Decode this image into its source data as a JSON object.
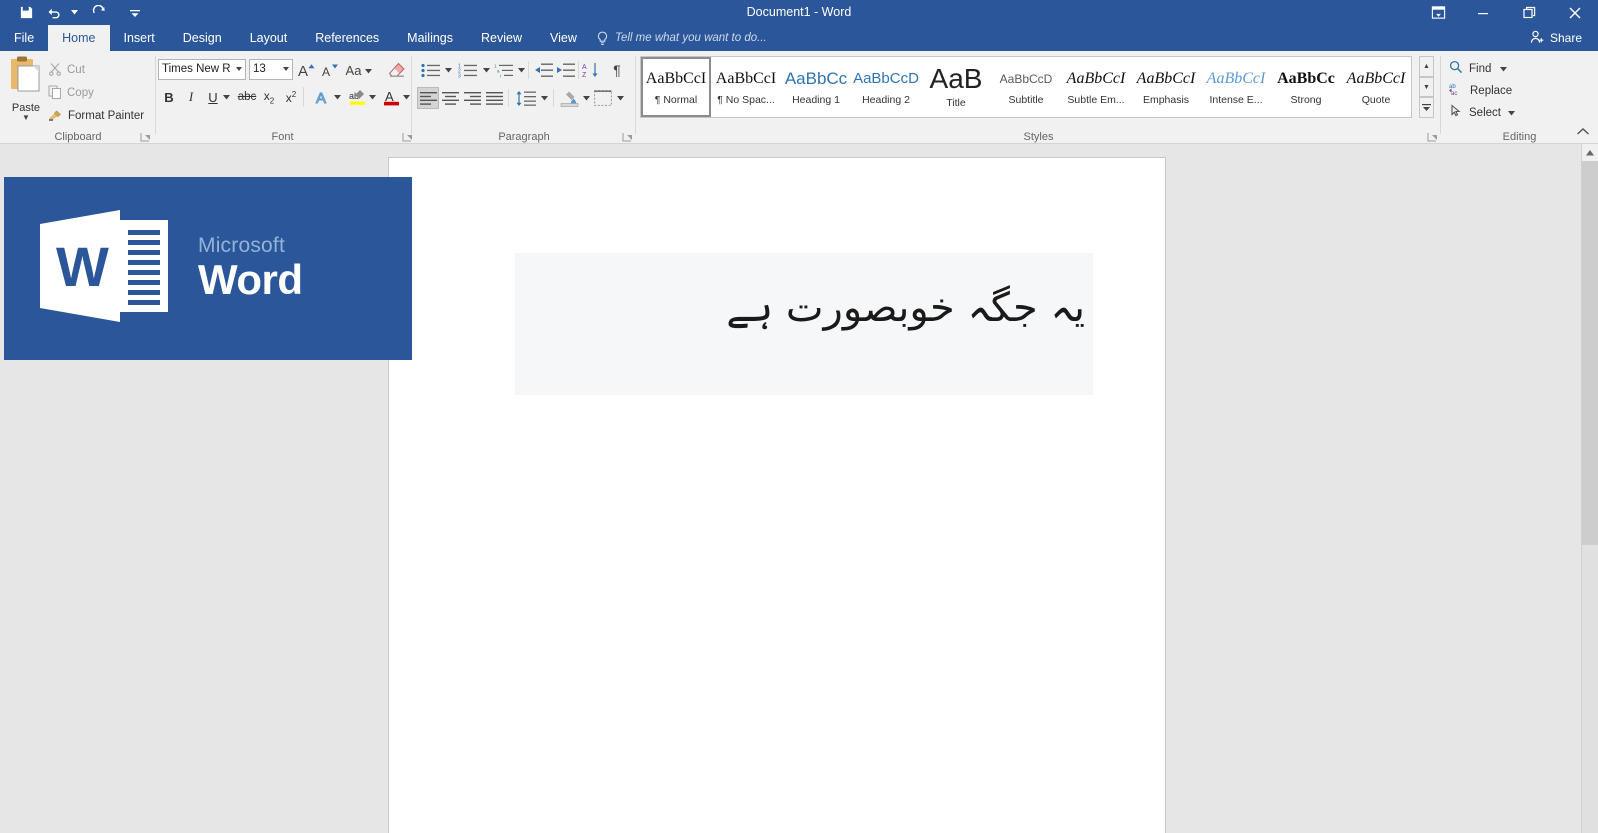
{
  "titlebar": {
    "document_title": "Document1 - Word",
    "qat": [
      {
        "name": "save-icon",
        "label": "Save"
      },
      {
        "name": "undo-icon",
        "label": "Undo"
      },
      {
        "name": "redo-icon",
        "label": "Repeat"
      },
      {
        "name": "customize-qat-icon",
        "label": "Customize Quick Access Toolbar"
      }
    ],
    "window": [
      {
        "name": "ribbon-display-options-icon",
        "label": "Ribbon Display Options"
      },
      {
        "name": "minimize-icon",
        "label": "Minimize"
      },
      {
        "name": "restore-icon",
        "label": "Restore Down"
      },
      {
        "name": "close-icon",
        "label": "Close"
      }
    ],
    "share_label": "Share",
    "accent_color": "#2b579a"
  },
  "tabs": [
    {
      "label": "File",
      "active": false
    },
    {
      "label": "Home",
      "active": true
    },
    {
      "label": "Insert",
      "active": false
    },
    {
      "label": "Design",
      "active": false
    },
    {
      "label": "Layout",
      "active": false
    },
    {
      "label": "References",
      "active": false
    },
    {
      "label": "Mailings",
      "active": false
    },
    {
      "label": "Review",
      "active": false
    },
    {
      "label": "View",
      "active": false
    }
  ],
  "tellme": {
    "placeholder": "Tell me what you want to do...",
    "icon": "lightbulb-icon"
  },
  "ribbon": {
    "clipboard": {
      "group_label": "Clipboard",
      "paste_label": "Paste",
      "cut_label": "Cut",
      "copy_label": "Copy",
      "format_painter_label": "Format Painter"
    },
    "font": {
      "group_label": "Font",
      "font_name": "Times New Ro",
      "font_size": "13",
      "buttons": [
        {
          "name": "grow-font-icon",
          "glyph": "A"
        },
        {
          "name": "shrink-font-icon",
          "glyph": "A"
        },
        {
          "name": "change-case-icon",
          "glyph": "Aa"
        },
        {
          "name": "clear-formatting-icon",
          "glyph": "✐"
        },
        {
          "name": "bold-icon",
          "glyph": "B"
        },
        {
          "name": "italic-icon",
          "glyph": "I"
        },
        {
          "name": "underline-icon",
          "glyph": "U"
        },
        {
          "name": "strikethrough-icon",
          "glyph": "abc"
        },
        {
          "name": "subscript-icon",
          "glyph": "x₂"
        },
        {
          "name": "superscript-icon",
          "glyph": "x²"
        },
        {
          "name": "text-effects-icon",
          "glyph": "A"
        },
        {
          "name": "text-highlight-color-icon",
          "glyph": "ab"
        },
        {
          "name": "font-color-icon",
          "glyph": "A"
        }
      ],
      "highlight_color": "#ffff00",
      "font_color": "#d00000"
    },
    "paragraph": {
      "group_label": "Paragraph",
      "buttons": [
        {
          "name": "bullets-icon"
        },
        {
          "name": "numbering-icon"
        },
        {
          "name": "multilevel-list-icon"
        },
        {
          "name": "decrease-indent-icon"
        },
        {
          "name": "increase-indent-icon"
        },
        {
          "name": "sort-icon"
        },
        {
          "name": "show-formatting-marks-icon"
        },
        {
          "name": "align-left-icon"
        },
        {
          "name": "align-center-icon"
        },
        {
          "name": "align-right-icon"
        },
        {
          "name": "justify-icon"
        },
        {
          "name": "line-spacing-icon"
        },
        {
          "name": "shading-icon"
        },
        {
          "name": "borders-icon"
        }
      ],
      "active_alignment": "align-left-icon"
    },
    "styles": {
      "group_label": "Styles",
      "items": [
        {
          "preview": "AaBbCcI",
          "name": "¶ Normal",
          "selected": true,
          "color": "#111111",
          "style": "serif"
        },
        {
          "preview": "AaBbCcI",
          "name": "¶ No Spac...",
          "selected": false,
          "color": "#111111",
          "style": "serif"
        },
        {
          "preview": "AaBbCc",
          "name": "Heading 1",
          "selected": false,
          "color": "#2e74b5",
          "style": "sans"
        },
        {
          "preview": "AaBbCcD",
          "name": "Heading 2",
          "selected": false,
          "color": "#2e74b5",
          "style": "sans"
        },
        {
          "preview": "AaB",
          "name": "Title",
          "selected": false,
          "color": "#222222",
          "style": "title"
        },
        {
          "preview": "AaBbCcD",
          "name": "Subtitle",
          "selected": false,
          "color": "#5a5a5a",
          "style": "sans-small"
        },
        {
          "preview": "AaBbCcI",
          "name": "Subtle Em...",
          "selected": false,
          "color": "#111111",
          "style": "italic"
        },
        {
          "preview": "AaBbCcI",
          "name": "Emphasis",
          "selected": false,
          "color": "#111111",
          "style": "italic"
        },
        {
          "preview": "AaBbCcI",
          "name": "Intense E...",
          "selected": false,
          "color": "#5b9bd5",
          "style": "italic"
        },
        {
          "preview": "AaBbCc",
          "name": "Strong",
          "selected": false,
          "color": "#111111",
          "style": "bold"
        },
        {
          "preview": "AaBbCcI",
          "name": "Quote",
          "selected": false,
          "color": "#111111",
          "style": "italic"
        }
      ],
      "scroll_up": "▲",
      "scroll_down": "▼",
      "more": "▾"
    },
    "editing": {
      "group_label": "Editing",
      "find_label": "Find",
      "replace_label": "Replace",
      "select_label": "Select"
    },
    "collapse_label": "Collapse the Ribbon"
  },
  "document": {
    "body_text": "یہ جگہ خوبصورت ہے",
    "selection_background": "#f5f7f9"
  },
  "splash": {
    "brand_small": "Microsoft",
    "brand_large": "Word",
    "logo_icon": "word-document-logo-icon",
    "background": "#2b579a"
  },
  "scrollbar": {
    "up_arrow": "▲",
    "down_arrow": "▼"
  }
}
